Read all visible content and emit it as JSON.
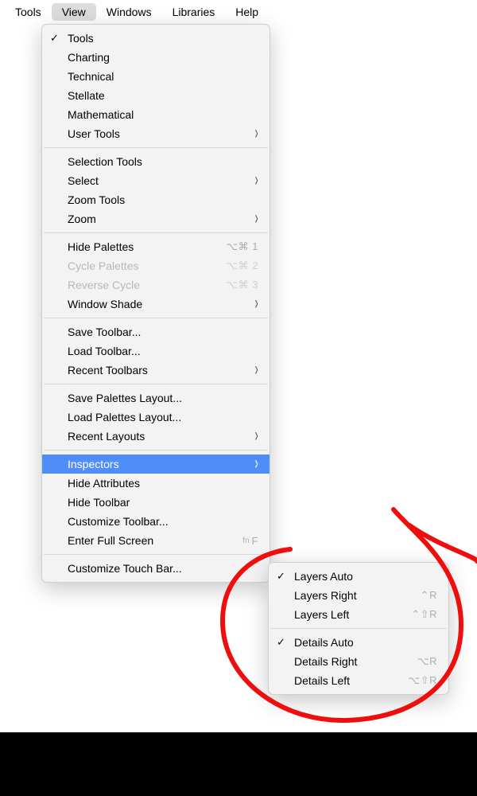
{
  "menubar": {
    "items": [
      "Tools",
      "View",
      "Windows",
      "Libraries",
      "Help"
    ],
    "active_index": 1
  },
  "view_menu": {
    "g0": [
      {
        "label": "Tools",
        "checked": true
      },
      {
        "label": "Charting"
      },
      {
        "label": "Technical"
      },
      {
        "label": "Stellate"
      },
      {
        "label": "Mathematical"
      },
      {
        "label": "User Tools",
        "submenu": true
      }
    ],
    "g1": [
      {
        "label": "Selection Tools"
      },
      {
        "label": "Select",
        "submenu": true
      },
      {
        "label": "Zoom Tools"
      },
      {
        "label": "Zoom",
        "submenu": true
      }
    ],
    "g2": [
      {
        "label": "Hide Palettes",
        "shortcut": "⌥⌘ 1"
      },
      {
        "label": "Cycle Palettes",
        "shortcut": "⌥⌘ 2",
        "disabled": true
      },
      {
        "label": "Reverse Cycle",
        "shortcut": "⌥⌘ 3",
        "disabled": true
      },
      {
        "label": "Window Shade",
        "submenu": true
      }
    ],
    "g3": [
      {
        "label": "Save Toolbar..."
      },
      {
        "label": "Load Toolbar..."
      },
      {
        "label": "Recent Toolbars",
        "submenu": true
      }
    ],
    "g4": [
      {
        "label": "Save Palettes Layout..."
      },
      {
        "label": "Load Palettes Layout..."
      },
      {
        "label": "Recent Layouts",
        "submenu": true
      }
    ],
    "g5": [
      {
        "label": "Inspectors",
        "submenu": true,
        "highlight": true
      },
      {
        "label": "Hide Attributes"
      },
      {
        "label": "Hide Toolbar"
      },
      {
        "label": "Customize Toolbar..."
      },
      {
        "label": "Enter Full Screen",
        "shortcut_fn": "fn",
        "shortcut": "F"
      }
    ],
    "g6": [
      {
        "label": "Customize Touch Bar..."
      }
    ]
  },
  "inspectors_submenu": {
    "g0": [
      {
        "label": "Layers Auto",
        "checked": true
      },
      {
        "label": "Layers Right",
        "shortcut": "⌃R"
      },
      {
        "label": "Layers Left",
        "shortcut": "⌃⇧R"
      }
    ],
    "g1": [
      {
        "label": "Details Auto",
        "checked": true
      },
      {
        "label": "Details Right",
        "shortcut": "⌥R"
      },
      {
        "label": "Details Left",
        "shortcut": "⌥⇧R"
      }
    ]
  }
}
